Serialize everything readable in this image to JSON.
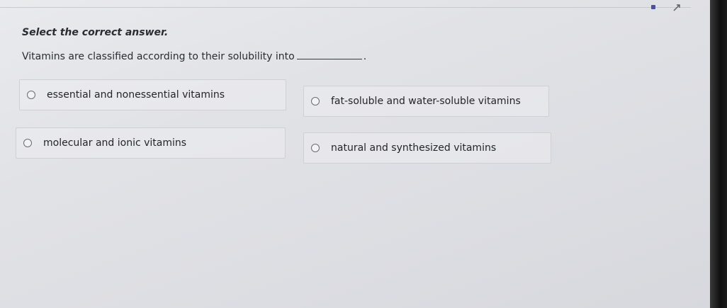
{
  "instruction": "Select the correct answer.",
  "question": {
    "text": "Vitamins are classified according to their solubility into",
    "end_punctuation": "."
  },
  "options": [
    {
      "id": "a",
      "label": "essential and nonessential vitamins",
      "selected": false
    },
    {
      "id": "b",
      "label": "fat-soluble and water-soluble vitamins",
      "selected": false
    },
    {
      "id": "c",
      "label": "molecular and ionic vitamins",
      "selected": false
    },
    {
      "id": "d",
      "label": "natural and synthesized vitamins",
      "selected": false
    }
  ],
  "colors": {
    "page_background": "#e3e4e8",
    "text": "#2b2b34",
    "option_border": "#cfd0d5",
    "corner_icon": "#4c4ea0"
  },
  "icons": [
    "square-icon",
    "expand-arrow-icon",
    "radio-button-icon"
  ]
}
